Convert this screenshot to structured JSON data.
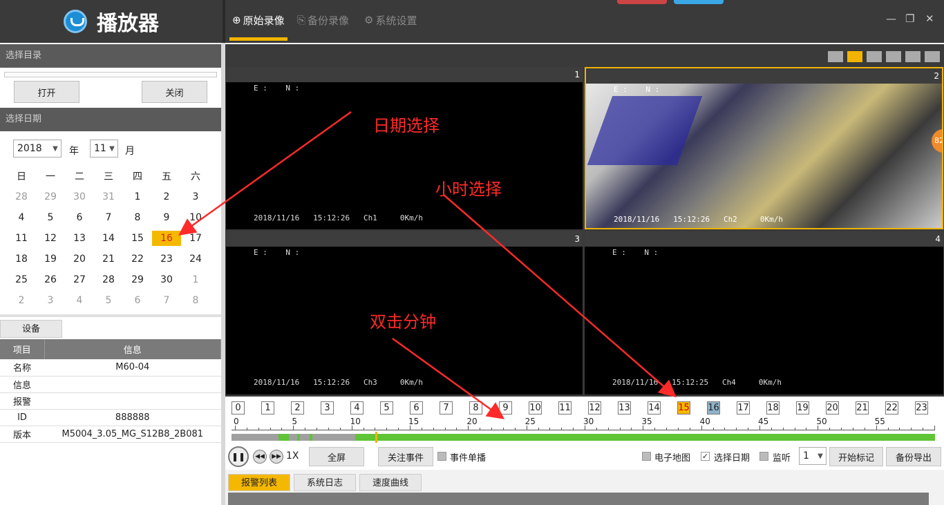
{
  "app": {
    "title": "播放器"
  },
  "tabs": [
    {
      "icon": "plus-circle-icon",
      "label": "原始录像"
    },
    {
      "icon": "backup-icon",
      "label": "备份录像"
    },
    {
      "icon": "gear-icon",
      "label": "系统设置"
    }
  ],
  "window": {
    "minimize": "—",
    "restore": "❐",
    "close": "✕"
  },
  "dir": {
    "title": "选择目录",
    "open": "打开",
    "close": "关闭"
  },
  "date": {
    "title": "选择日期",
    "year": "2018",
    "year_label": "年",
    "month": "11",
    "month_label": "月",
    "weekdays": [
      "日",
      "一",
      "二",
      "三",
      "四",
      "五",
      "六"
    ],
    "weeks": [
      [
        "28",
        "29",
        "30",
        "31",
        "1",
        "2",
        "3"
      ],
      [
        "4",
        "5",
        "6",
        "7",
        "8",
        "9",
        "10"
      ],
      [
        "11",
        "12",
        "13",
        "14",
        "15",
        "16",
        "17"
      ],
      [
        "18",
        "19",
        "20",
        "21",
        "22",
        "23",
        "24"
      ],
      [
        "25",
        "26",
        "27",
        "28",
        "29",
        "30",
        "1"
      ],
      [
        "2",
        "3",
        "4",
        "5",
        "6",
        "7",
        "8"
      ]
    ],
    "selected_day": "16"
  },
  "device": {
    "tab": "设备",
    "headers": [
      "项目",
      "信息"
    ],
    "rows": [
      [
        "名称",
        "M60-04"
      ],
      [
        "信息",
        ""
      ],
      [
        "报警",
        ""
      ],
      [
        "ID",
        "888888"
      ],
      [
        "版本",
        "M5004_3.05_MG_S12B8_2B081"
      ]
    ]
  },
  "channels": [
    {
      "num": "1",
      "gps": "E :    N :",
      "stamp": "2018/11/16   15:12:26   Ch1     0Km/h"
    },
    {
      "num": "2",
      "gps": "E :    N :",
      "stamp": "2018/11/16   15:12:26   Ch2     0Km/h",
      "badge": "82"
    },
    {
      "num": "3",
      "gps": "E :    N :",
      "stamp": "2018/11/16   15:12:26   Ch3     0Km/h"
    },
    {
      "num": "4",
      "gps": "E :    N :",
      "stamp": "2018/11/16   15:12:25   Ch4     0Km/h"
    }
  ],
  "hours": [
    "0",
    "1",
    "2",
    "3",
    "4",
    "5",
    "6",
    "7",
    "8",
    "9",
    "10",
    "11",
    "12",
    "13",
    "14",
    "15",
    "16",
    "17",
    "18",
    "19",
    "20",
    "21",
    "22",
    "23"
  ],
  "current_hour": "15",
  "marked_hour": "16",
  "minute_labels": [
    "0",
    "5",
    "10",
    "15",
    "20",
    "25",
    "30",
    "35",
    "40",
    "45",
    "50",
    "55"
  ],
  "controls": {
    "speed": "1X",
    "fullscreen": "全屏",
    "events": "关注事件",
    "single_event": "事件单播",
    "emap": "电子地图",
    "select_date": "选择日期",
    "monitor": "监听",
    "count": "1",
    "start_mark": "开始标记",
    "backup_export": "备份导出"
  },
  "bottom_tabs": [
    "报警列表",
    "系统日志",
    "速度曲线"
  ],
  "annotations": {
    "date": "日期选择",
    "hour": "小时选择",
    "minute": "双击分钟"
  },
  "colors": {
    "accent": "#f5b800",
    "timeline": "#5fc436",
    "annotation": "#ff2a2a"
  }
}
